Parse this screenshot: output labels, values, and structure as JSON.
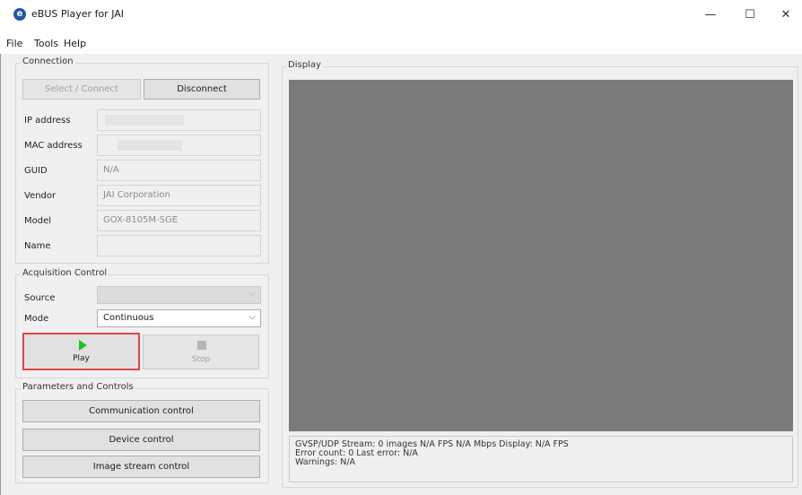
{
  "window": {
    "title": "eBUS Player for JAI",
    "app_icon_glyph": "e",
    "controls": {
      "minimize": "—",
      "maximize": "☐",
      "close": "✕"
    }
  },
  "menu": [
    "File",
    "Tools",
    "Help"
  ],
  "connection": {
    "group_title": "Connection",
    "select_connect_label": "Select / Connect",
    "disconnect_label": "Disconnect",
    "fields": [
      {
        "label": "IP address",
        "value": ""
      },
      {
        "label": "MAC address",
        "value": ""
      },
      {
        "label": "GUID",
        "value": "N/A"
      },
      {
        "label": "Vendor",
        "value": "JAI Corporation"
      },
      {
        "label": "Model",
        "value": "GOX-8105M-SGE"
      },
      {
        "label": "Name",
        "value": ""
      }
    ]
  },
  "acquisition": {
    "group_title": "Acquisition Control",
    "source_label": "Source",
    "source_value": "",
    "mode_label": "Mode",
    "mode_value": "Continuous",
    "play_label": "Play",
    "stop_label": "Stop"
  },
  "parameters": {
    "group_title": "Parameters and Controls",
    "buttons": [
      "Communication control",
      "Device control",
      "Image stream control"
    ]
  },
  "display": {
    "group_title": "Display",
    "status_lines": [
      "GVSP/UDP Stream: 0 images    N/A FPS    N/A Mbps    Display: N/A FPS",
      "Error count: 0    Last error: N/A",
      "Warnings: N/A"
    ]
  },
  "colors": {
    "highlight_box": "#e04545",
    "play_icon": "#20c020",
    "display_background": "#7a7a7a"
  }
}
